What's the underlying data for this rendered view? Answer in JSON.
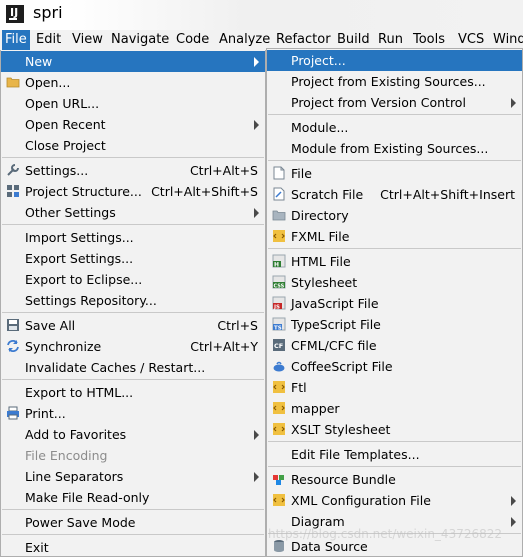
{
  "window": {
    "title": "spri"
  },
  "menubar": [
    "File",
    "Edit",
    "View",
    "Navigate",
    "Code",
    "Analyze",
    "Refactor",
    "Build",
    "Run",
    "Tools",
    "VCS",
    "Wind"
  ],
  "file_menu": [
    {
      "label": "New",
      "submenu": true,
      "selected": true
    },
    {
      "label": "Open...",
      "icon": "folder-icon"
    },
    {
      "label": "Open URL..."
    },
    {
      "label": "Open Recent",
      "submenu": true
    },
    {
      "label": "Close Project"
    },
    {
      "label": "Settings...",
      "shortcut": "Ctrl+Alt+S",
      "icon": "wrench-icon"
    },
    {
      "label": "Project Structure...",
      "shortcut": "Ctrl+Alt+Shift+S",
      "icon": "structure-icon"
    },
    {
      "label": "Other Settings",
      "submenu": true
    },
    {
      "label": "Import Settings..."
    },
    {
      "label": "Export Settings..."
    },
    {
      "label": "Export to Eclipse..."
    },
    {
      "label": "Settings Repository..."
    },
    {
      "label": "Save All",
      "shortcut": "Ctrl+S",
      "icon": "save-icon"
    },
    {
      "label": "Synchronize",
      "shortcut": "Ctrl+Alt+Y",
      "icon": "sync-icon"
    },
    {
      "label": "Invalidate Caches / Restart..."
    },
    {
      "label": "Export to HTML..."
    },
    {
      "label": "Print...",
      "icon": "print-icon"
    },
    {
      "label": "Add to Favorites",
      "submenu": true
    },
    {
      "label": "File Encoding",
      "disabled": true
    },
    {
      "label": "Line Separators",
      "submenu": true
    },
    {
      "label": "Make File Read-only"
    },
    {
      "label": "Power Save Mode"
    },
    {
      "label": "Exit"
    }
  ],
  "new_menu": [
    {
      "label": "Project...",
      "selected": true
    },
    {
      "label": "Project from Existing Sources..."
    },
    {
      "label": "Project from Version Control",
      "submenu": true
    },
    {
      "label": "Module..."
    },
    {
      "label": "Module from Existing Sources..."
    },
    {
      "label": "File",
      "icon": "file-icon"
    },
    {
      "label": "Scratch File",
      "shortcut": "Ctrl+Alt+Shift+Insert",
      "icon": "scratch-file-icon"
    },
    {
      "label": "Directory",
      "icon": "directory-icon"
    },
    {
      "label": "FXML File",
      "icon": "fxml-file-icon"
    },
    {
      "label": "HTML File",
      "icon": "html-file-icon"
    },
    {
      "label": "Stylesheet",
      "icon": "css-file-icon"
    },
    {
      "label": "JavaScript File",
      "icon": "javascript-file-icon"
    },
    {
      "label": "TypeScript File",
      "icon": "typescript-file-icon"
    },
    {
      "label": "CFML/CFC file",
      "icon": "cfml-file-icon"
    },
    {
      "label": "CoffeeScript File",
      "icon": "coffeescript-file-icon"
    },
    {
      "label": "Ftl",
      "icon": "ftl-file-icon"
    },
    {
      "label": "mapper",
      "icon": "mapper-file-icon"
    },
    {
      "label": "XSLT Stylesheet",
      "icon": "xslt-file-icon"
    },
    {
      "label": "Edit File Templates..."
    },
    {
      "label": "Resource Bundle",
      "icon": "resource-bundle-icon"
    },
    {
      "label": "XML Configuration File",
      "submenu": true,
      "icon": "xml-config-icon"
    },
    {
      "label": "Diagram",
      "submenu": true
    },
    {
      "label": "Data Source",
      "submenu": true,
      "icon": "data-source-icon"
    }
  ],
  "watermark": "https://blog.csdn.net/weixin_43726822",
  "colors": {
    "selection": "#2675bf",
    "menu_bg": "#f2f2f2"
  }
}
